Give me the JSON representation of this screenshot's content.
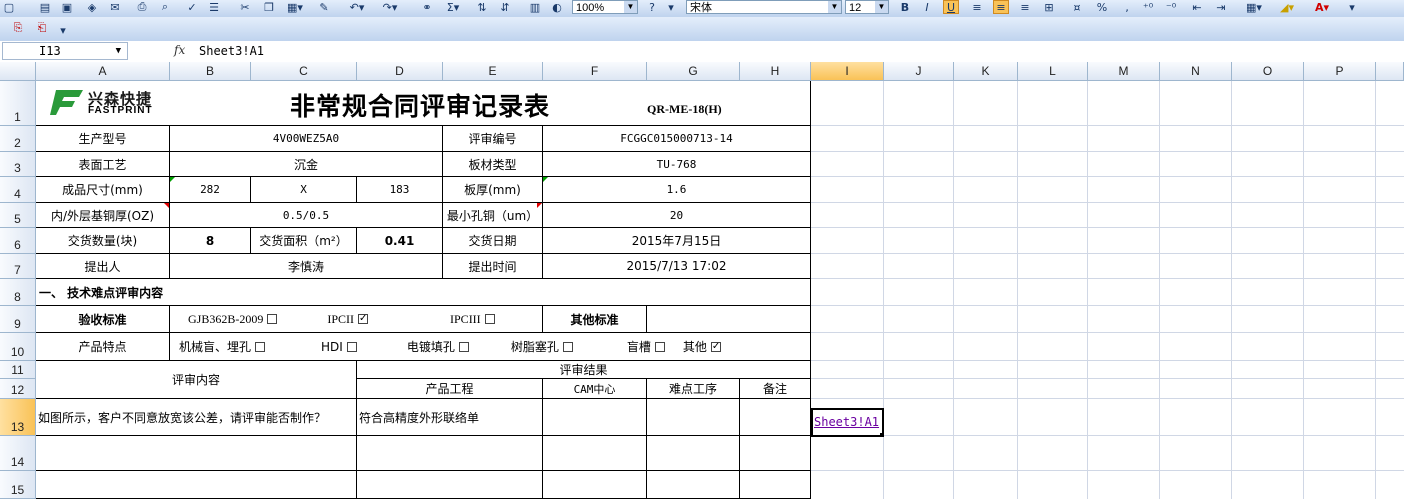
{
  "toolbar": {
    "zoom": "100%",
    "font_name": "宋体",
    "font_size": "12",
    "bold": "B",
    "italic": "I",
    "underline": "U",
    "percent": "%",
    "sum": "Σ"
  },
  "formula_bar": {
    "name_box": "I13",
    "fx": "fx",
    "value": "Sheet3!A1"
  },
  "columns": [
    "A",
    "B",
    "C",
    "D",
    "E",
    "F",
    "G",
    "H",
    "I",
    "J",
    "K",
    "L",
    "M",
    "N",
    "O",
    "P"
  ],
  "rows": [
    "1",
    "2",
    "3",
    "4",
    "5",
    "6",
    "7",
    "8",
    "9",
    "10",
    "11",
    "12",
    "13",
    "14",
    "15"
  ],
  "sheet": {
    "logo_cn": "兴森快捷",
    "logo_en": "FASTPRINT",
    "title": "非常规合同评审记录表",
    "doc_code": "QR-ME-18(H)",
    "r2": {
      "a": "生产型号",
      "b": "4V00WEZ5A0",
      "e": "评审编号",
      "f": "FCGGC015000713-14"
    },
    "r3": {
      "a": "表面工艺",
      "b": "沉金",
      "e": "板材类型",
      "f": "TU-768"
    },
    "r4": {
      "a": "成品尺寸(mm)",
      "b": "282",
      "c": "X",
      "d": "183",
      "e": "板厚(mm)",
      "f": "1.6"
    },
    "r5": {
      "a": "内/外层基铜厚(OZ)",
      "b": "0.5/0.5",
      "e": "最小孔铜（um）",
      "f": "20"
    },
    "r6": {
      "a": "交货数量(块)",
      "b": "8",
      "c": "交货面积（m²）",
      "d": "0.41",
      "e": "交货日期",
      "f": "2015年7月15日"
    },
    "r7": {
      "a": "提出人",
      "b": "李慎涛",
      "e": "提出时间",
      "f": "2015/7/13 17:02"
    },
    "r8": {
      "a": "一、 技术难点评审内容"
    },
    "r9": {
      "a": "验收标准",
      "opt1": "GJB362B-2009",
      "opt2": "IPCII",
      "opt3": "IPCIII",
      "other": "其他标准",
      "check_on": "✓"
    },
    "r10": {
      "a": "产品特点",
      "f1": "机械盲、埋孔",
      "f2": "HDI",
      "f3": "电镀填孔",
      "f4": "树脂塞孔",
      "f5": "盲槽",
      "f6": "其他"
    },
    "r11": {
      "a": "评审内容",
      "result": "评审结果"
    },
    "r12": {
      "c": "产品工程",
      "f": "CAM中心",
      "g": "难点工序",
      "h": "备注"
    },
    "r13": {
      "a": "如图所示，客户不同意放宽该公差，请评审能否制作？",
      "c": "符合高精度外形联络单",
      "i": "Sheet3!A1"
    }
  }
}
